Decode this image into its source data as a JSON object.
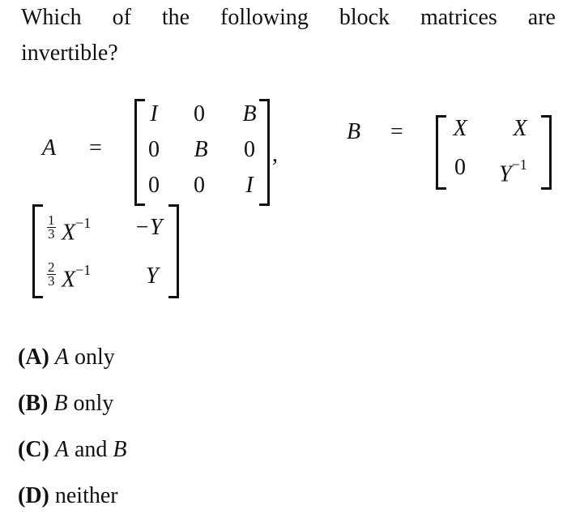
{
  "question": {
    "line1_words": [
      "Which",
      "of",
      "the",
      "following",
      "block",
      "matrices",
      "are"
    ],
    "line2": "invertible?"
  },
  "matrix_A": {
    "name": "A",
    "equals": "=",
    "rows": [
      [
        "I",
        "0",
        "B"
      ],
      [
        "0",
        "B",
        "0"
      ],
      [
        "0",
        "0",
        "I"
      ]
    ],
    "trailing": ","
  },
  "matrix_B": {
    "name": "B",
    "equals": "=",
    "rows": [
      [
        "X",
        "X"
      ],
      [
        "0",
        "Y",
        "−1"
      ]
    ],
    "r1c1": "X",
    "r1c2": "X",
    "r2c1": "0",
    "r2c2_base": "Y",
    "r2c2_exp": "−1"
  },
  "matrix_C": {
    "r1c1_frac_num": "1",
    "r1c1_frac_den": "3",
    "r1c1_base": "X",
    "r1c1_exp": "−1",
    "r1c2": "−Y",
    "r2c1_frac_num": "2",
    "r2c1_frac_den": "3",
    "r2c1_base": "X",
    "r2c1_exp": "−1",
    "r2c2": "Y"
  },
  "options": [
    {
      "label": "(A)",
      "var": "A",
      "text": " only"
    },
    {
      "label": "(B)",
      "var": "B",
      "text": " only"
    },
    {
      "label": "(C)",
      "var": "A",
      "text": " and ",
      "var2": "B"
    },
    {
      "label": "(D)",
      "text": " neither"
    }
  ]
}
